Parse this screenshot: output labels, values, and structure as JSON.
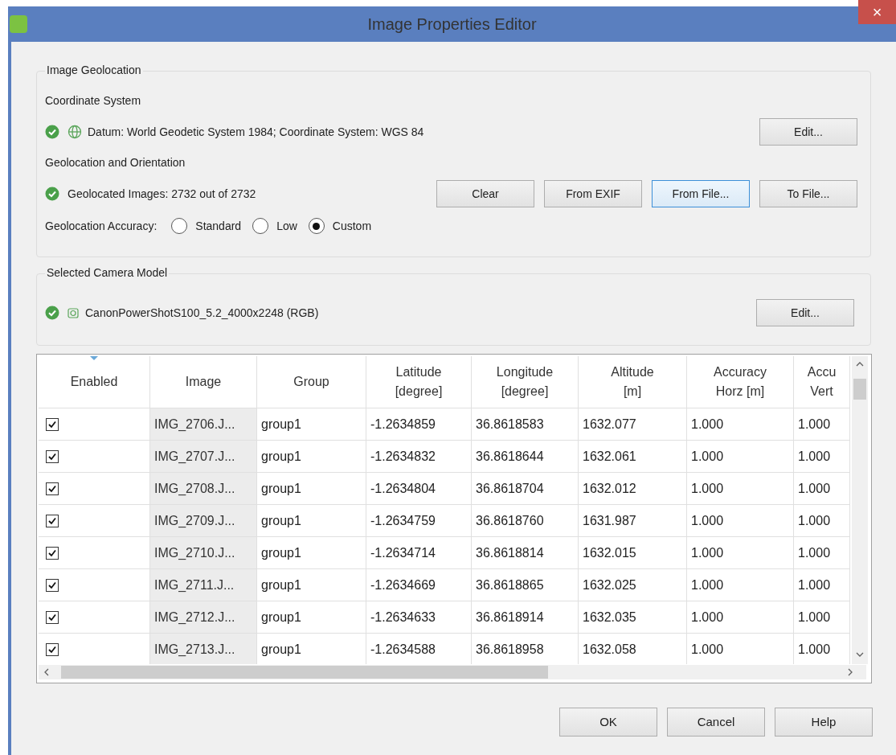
{
  "window": {
    "title": "Image Properties Editor",
    "close": "×"
  },
  "image_geolocation": {
    "title": "Image Geolocation",
    "coordinate_system": {
      "heading": "Coordinate System",
      "ok": true,
      "text": "Datum: World Geodetic System 1984; Coordinate System: WGS 84",
      "button": "Edit..."
    },
    "orientation": {
      "heading": "Geolocation and Orientation",
      "ok": true,
      "text": "Geolocated Images: 2732 out of 2732",
      "buttons": [
        {
          "label": "Clear",
          "focused": false
        },
        {
          "label": "From EXIF",
          "focused": false
        },
        {
          "label": "From File...",
          "focused": true
        },
        {
          "label": "To File...",
          "focused": false
        }
      ]
    },
    "accuracy": {
      "label": "Geolocation Accuracy:",
      "options": [
        {
          "label": "Standard",
          "selected": false
        },
        {
          "label": "Low",
          "selected": false
        },
        {
          "label": "Custom",
          "selected": true
        }
      ]
    }
  },
  "camera_model": {
    "title": "Selected Camera Model",
    "ok": true,
    "text": "CanonPowerShotS100_5.2_4000x2248 (RGB)",
    "button": "Edit..."
  },
  "table": {
    "columns": [
      "Enabled",
      "Image",
      "Group",
      "Latitude\n[degree]",
      "Longitude\n[degree]",
      "Altitude\n[m]",
      "Accuracy\nHorz [m]",
      "Accu\nVert"
    ],
    "rows": [
      {
        "checked": true,
        "cells": [
          "",
          "IMG_2706.J...",
          "group1",
          "-1.2634859",
          "36.8618583",
          "1632.077",
          "1.000",
          "1.000"
        ]
      },
      {
        "checked": true,
        "cells": [
          "",
          "IMG_2707.J...",
          "group1",
          "-1.2634832",
          "36.8618644",
          "1632.061",
          "1.000",
          "1.000"
        ]
      },
      {
        "checked": true,
        "cells": [
          "",
          "IMG_2708.J...",
          "group1",
          "-1.2634804",
          "36.8618704",
          "1632.012",
          "1.000",
          "1.000"
        ]
      },
      {
        "checked": true,
        "cells": [
          "",
          "IMG_2709.J...",
          "group1",
          "-1.2634759",
          "36.8618760",
          "1631.987",
          "1.000",
          "1.000"
        ]
      },
      {
        "checked": true,
        "cells": [
          "",
          "IMG_2710.J...",
          "group1",
          "-1.2634714",
          "36.8618814",
          "1632.015",
          "1.000",
          "1.000"
        ]
      },
      {
        "checked": true,
        "cells": [
          "",
          "IMG_2711.J...",
          "group1",
          "-1.2634669",
          "36.8618865",
          "1632.025",
          "1.000",
          "1.000"
        ]
      },
      {
        "checked": true,
        "cells": [
          "",
          "IMG_2712.J...",
          "group1",
          "-1.2634633",
          "36.8618914",
          "1632.035",
          "1.000",
          "1.000"
        ]
      },
      {
        "checked": true,
        "cells": [
          "",
          "IMG_2713.J...",
          "group1",
          "-1.2634588",
          "36.8618958",
          "1632.058",
          "1.000",
          "1.000"
        ]
      }
    ]
  },
  "buttons": [
    "OK",
    "Cancel",
    "Help"
  ]
}
